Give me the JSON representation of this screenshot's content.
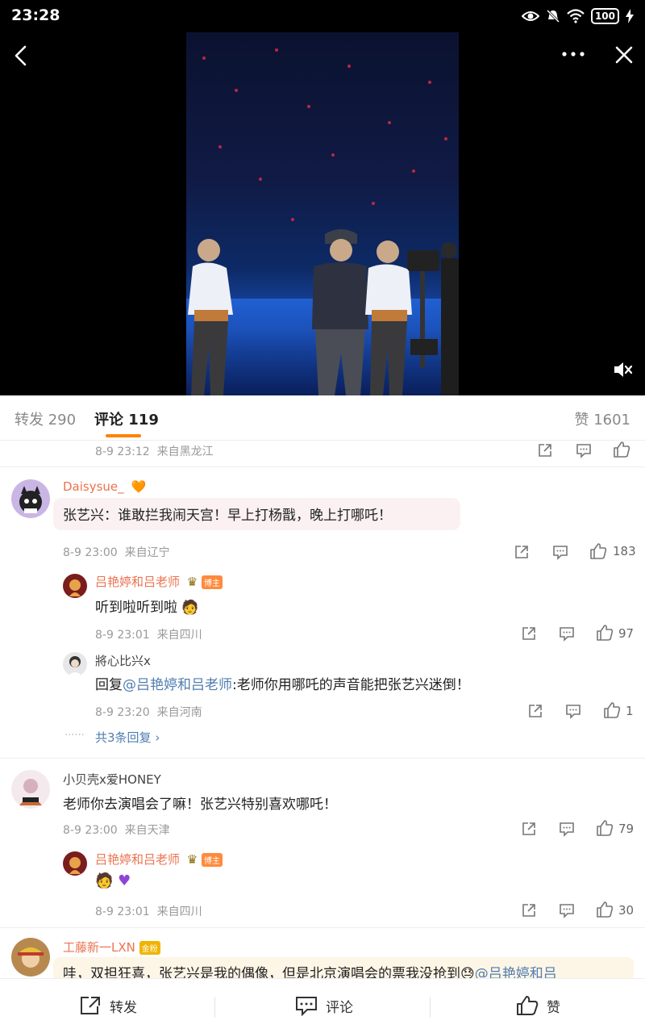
{
  "status_bar": {
    "time": "23:28",
    "battery": "100"
  },
  "tabs": {
    "repost": "转发 290",
    "comment": "评论 119",
    "like": "赞 1601"
  },
  "top_meta": {
    "time": "8-9 23:12",
    "loc": "来自黑龙江"
  },
  "comments": [
    {
      "user": "Daisysue_",
      "text": "张艺兴：谁敢拦我闹天宫！早上打杨戬，晚上打哪吒！",
      "time": "8-9 23:00",
      "loc": "来自辽宁",
      "likes": "183",
      "replies": [
        {
          "user": "吕艳婷和吕老师",
          "badge": "博主",
          "text": "听到啦听到啦",
          "time": "8-9 23:01",
          "loc": "来自四川",
          "likes": "97"
        },
        {
          "user": "將心比兴x",
          "reply_prefix": "回复",
          "mention": "@吕艳婷和吕老师",
          "text": ":老师你用哪吒的声音能把张艺兴迷倒！",
          "time": "8-9 23:20",
          "loc": "来自河南",
          "likes": "1"
        }
      ],
      "more_replies": "共3条回复"
    },
    {
      "user": "小贝壳x爱HONEY",
      "text": "老师你去演唱会了嘛！张艺兴特别喜欢哪吒！",
      "time": "8-9 23:00",
      "loc": "来自天津",
      "likes": "79",
      "replies": [
        {
          "user": "吕艳婷和吕老师",
          "badge": "博主",
          "time": "8-9 23:01",
          "loc": "来自四川",
          "likes": "30"
        }
      ]
    },
    {
      "user": "工藤新一LXN",
      "badge": "金粉",
      "text": "哇，双担狂喜，张艺兴是我的偶像，但是北京演唱会的票我没抢到",
      "mention": "@吕艳婷和吕"
    }
  ],
  "bottom_bar": {
    "repost": "转发",
    "comment": "评论",
    "like": "赞"
  },
  "colors": {
    "accent": "#ff8200",
    "username": "#eb7350",
    "mention": "#507daf"
  }
}
